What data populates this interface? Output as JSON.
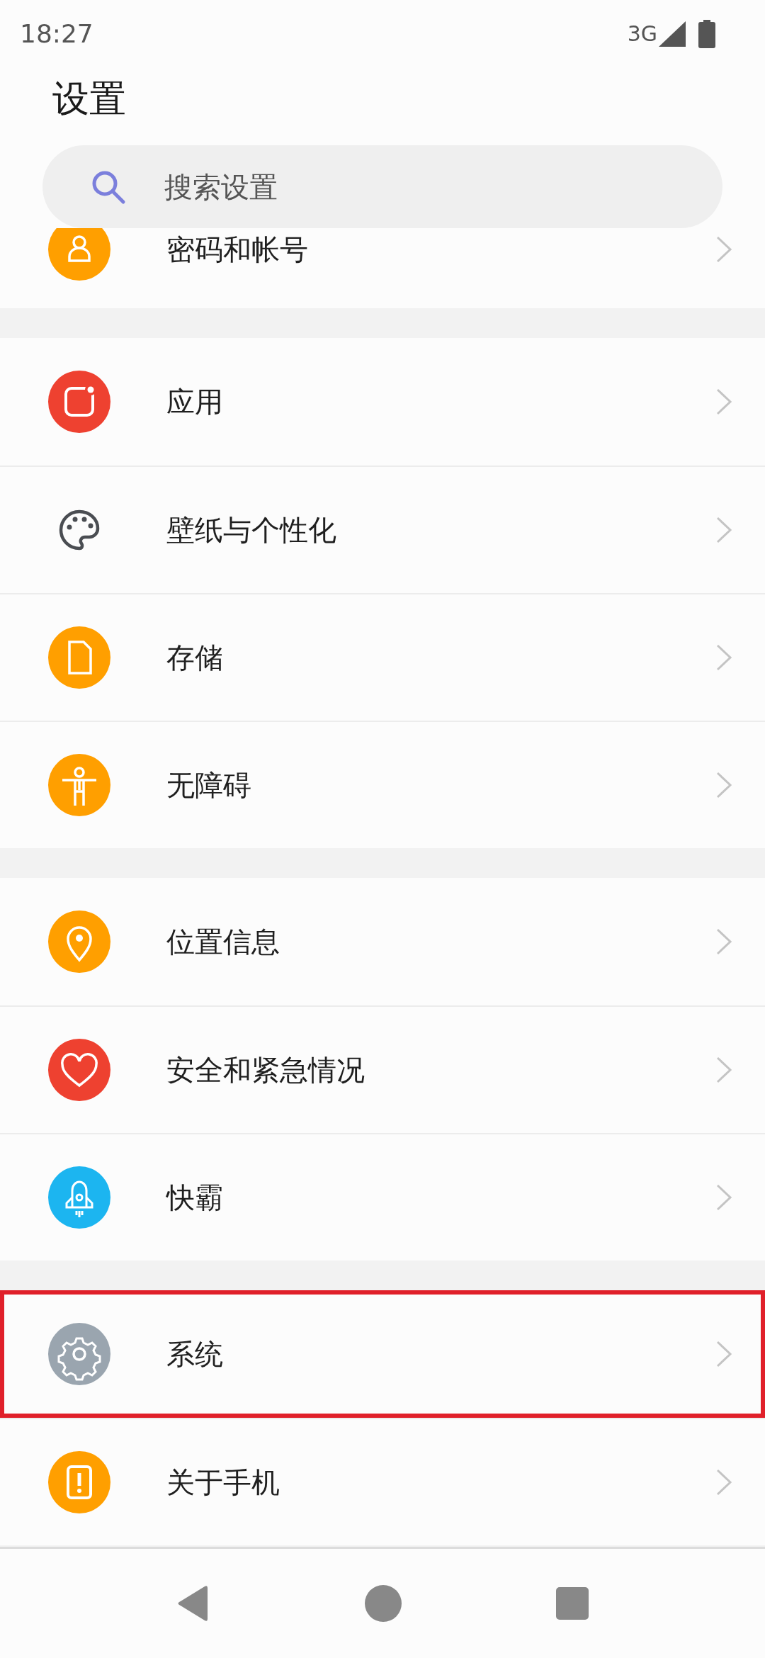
{
  "status_bar": {
    "time": "18:27",
    "network": "3G"
  },
  "title": "设置",
  "search": {
    "placeholder": "搜索设置"
  },
  "groups": [
    {
      "items": [
        {
          "label": "密码和帐号",
          "color": "#ff9f00",
          "highlighted": false
        }
      ]
    },
    {
      "items": [
        {
          "label": "应用",
          "color": "#ee4130",
          "highlighted": false
        },
        {
          "label": "壁纸与个性化",
          "highlighted": false
        },
        {
          "label": "存储",
          "color": "#ff9f00",
          "highlighted": false
        },
        {
          "label": "无障碍",
          "color": "#ff9f00",
          "highlighted": false
        }
      ]
    },
    {
      "items": [
        {
          "label": "位置信息",
          "color": "#ff9f00",
          "highlighted": false
        },
        {
          "label": "安全和紧急情况",
          "color": "#ee4130",
          "highlighted": false
        },
        {
          "label": "快霸",
          "color": "#1cb5f0",
          "highlighted": false
        }
      ]
    },
    {
      "items": [
        {
          "label": "系统",
          "color": "#9aa5af",
          "highlighted": true
        },
        {
          "label": "关于手机",
          "color": "#ff9f00",
          "highlighted": false
        }
      ]
    }
  ]
}
